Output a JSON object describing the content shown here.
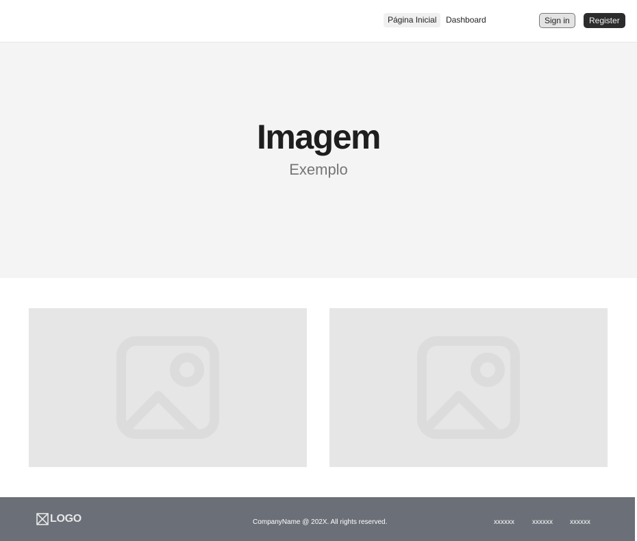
{
  "header": {
    "nav": [
      {
        "label": "Página Inicial",
        "active": true
      },
      {
        "label": "Dashboard",
        "active": false
      }
    ],
    "sign_in_label": "Sign in",
    "register_label": "Register"
  },
  "hero": {
    "title": "Imagem",
    "subtitle": "Exemplo"
  },
  "gallery": {
    "cards": [
      {
        "icon": "image-placeholder-icon"
      },
      {
        "icon": "image-placeholder-icon"
      }
    ]
  },
  "footer": {
    "logo_text": "LOGO",
    "copyright": "CompanyName @ 202X. All rights reserved.",
    "links": [
      "xxxxxx",
      "xxxxxx",
      "xxxxxx"
    ]
  },
  "colors": {
    "hero_bg": "#f4f4f4",
    "card_bg": "#e6e6e6",
    "footer_bg": "#6b6f77",
    "register_bg": "#2c2c2c",
    "text_primary": "#1e1e1e",
    "text_secondary": "#757575"
  }
}
